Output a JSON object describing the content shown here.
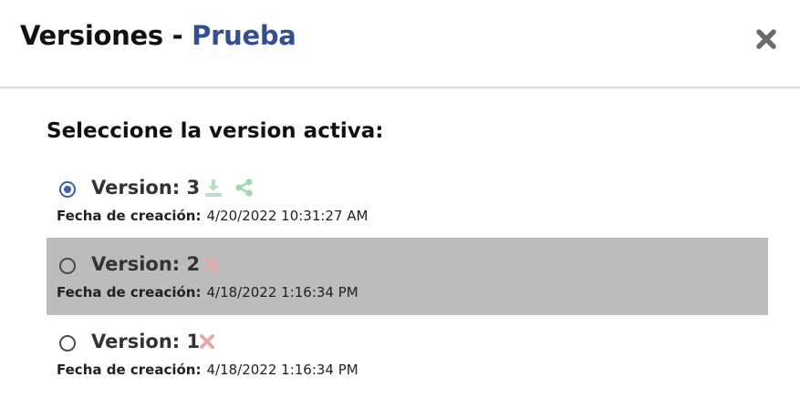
{
  "dialog": {
    "title_prefix": "Versiones - ",
    "project_name": "Prueba",
    "close_icon": "close-icon"
  },
  "section_title": "Seleccione la version activa:",
  "colors": {
    "project_name": "#334f8f",
    "radio_checked": "#3f5bb8",
    "download_icon": "#b5e0c4",
    "share_icon": "#9fd9b4",
    "delete_icon": "#e6a7a7",
    "highlight_row": "#bcbcbc"
  },
  "versions": [
    {
      "label": "Version: 3",
      "selected": true,
      "date_label": "Fecha de creación:",
      "date_value": "4/20/2022 10:31:27 AM",
      "actions": [
        "download-icon",
        "share-icon"
      ]
    },
    {
      "label": "Version: 2",
      "selected": false,
      "highlighted": true,
      "date_label": "Fecha de creación:",
      "date_value": "4/18/2022 1:16:34 PM",
      "actions": [
        "delete-icon"
      ]
    },
    {
      "label": "Version: 1",
      "selected": false,
      "date_label": "Fecha de creación:",
      "date_value": "4/18/2022 1:16:34 PM",
      "actions": [
        "delete-icon"
      ]
    }
  ]
}
